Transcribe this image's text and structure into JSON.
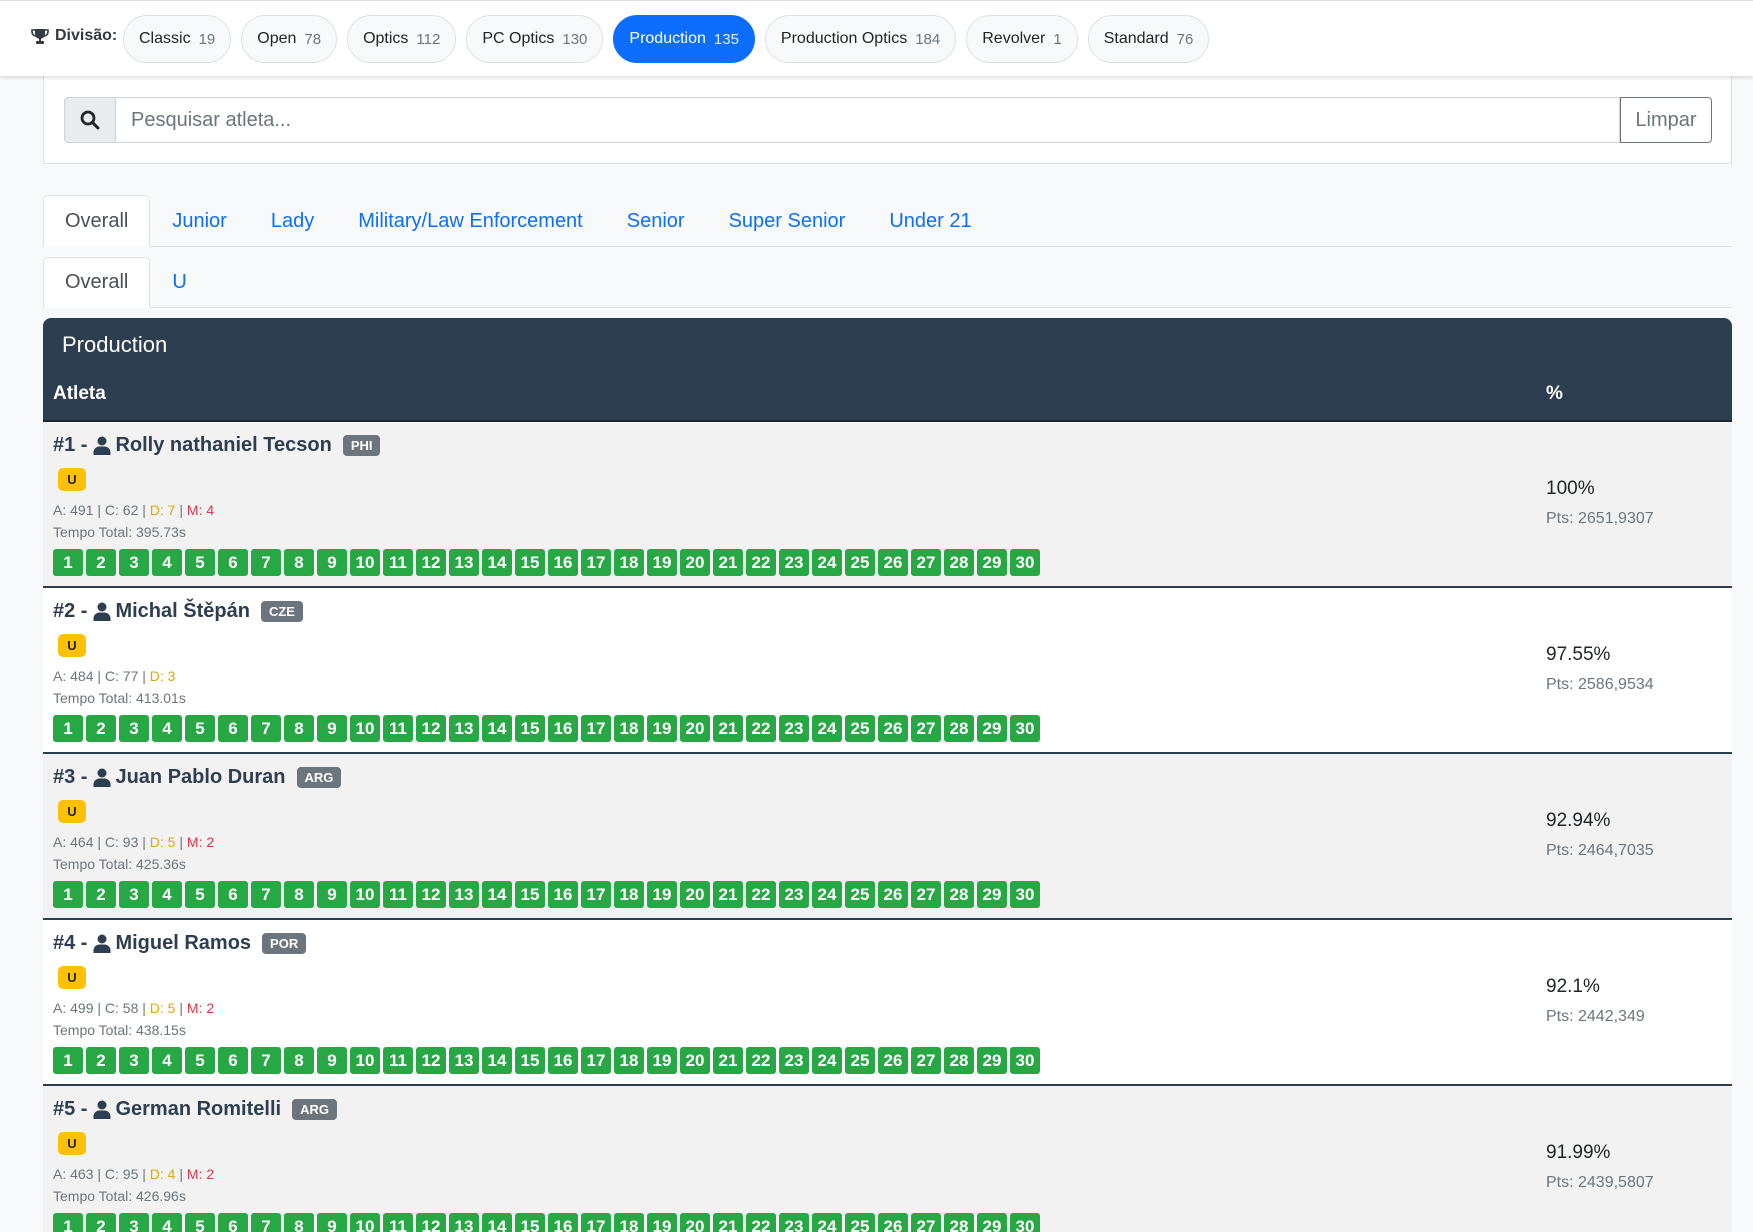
{
  "division": {
    "label": "Divisão:",
    "pills": [
      {
        "name": "Classic",
        "count": "19",
        "active": false
      },
      {
        "name": "Open",
        "count": "78",
        "active": false
      },
      {
        "name": "Optics",
        "count": "112",
        "active": false
      },
      {
        "name": "PC Optics",
        "count": "130",
        "active": false
      },
      {
        "name": "Production",
        "count": "135",
        "active": true
      },
      {
        "name": "Production Optics",
        "count": "184",
        "active": false
      },
      {
        "name": "Revolver",
        "count": "1",
        "active": false
      },
      {
        "name": "Standard",
        "count": "76",
        "active": false
      }
    ]
  },
  "search": {
    "placeholder": "Pesquisar atleta...",
    "value": "",
    "clear_label": "Limpar"
  },
  "category_tabs": [
    {
      "label": "Overall",
      "active": true
    },
    {
      "label": "Junior",
      "active": false
    },
    {
      "label": "Lady",
      "active": false
    },
    {
      "label": "Military/Law Enforcement",
      "active": false
    },
    {
      "label": "Senior",
      "active": false
    },
    {
      "label": "Super Senior",
      "active": false
    },
    {
      "label": "Under 21",
      "active": false
    }
  ],
  "sub_tabs": [
    {
      "label": "Overall",
      "active": true
    },
    {
      "label": "U",
      "active": false
    }
  ],
  "results": {
    "title": "Production",
    "col_athlete": "Atleta",
    "col_percent": "%",
    "stages": [
      "1",
      "2",
      "3",
      "4",
      "5",
      "6",
      "7",
      "8",
      "9",
      "10",
      "11",
      "12",
      "13",
      "14",
      "15",
      "16",
      "17",
      "18",
      "19",
      "20",
      "21",
      "22",
      "23",
      "24",
      "25",
      "26",
      "27",
      "28",
      "29",
      "30"
    ],
    "rows": [
      {
        "rank": "#1 -",
        "name": "Rolly nathaniel Tecson",
        "country": "PHI",
        "badge": "U",
        "a": "A: 491",
        "c": "C: 62",
        "d": "D: 7",
        "m": "M: 4",
        "time": "Tempo Total: 395.73s",
        "percent": "100%",
        "points": "Pts: 2651,9307"
      },
      {
        "rank": "#2 -",
        "name": "Michal Štěpán",
        "country": "CZE",
        "badge": "U",
        "a": "A: 484",
        "c": "C: 77",
        "d": "D: 3",
        "m": "",
        "time": "Tempo Total: 413.01s",
        "percent": "97.55%",
        "points": "Pts: 2586,9534"
      },
      {
        "rank": "#3 -",
        "name": "Juan Pablo Duran",
        "country": "ARG",
        "badge": "U",
        "a": "A: 464",
        "c": "C: 93",
        "d": "D: 5",
        "m": "M: 2",
        "time": "Tempo Total: 425.36s",
        "percent": "92.94%",
        "points": "Pts: 2464,7035"
      },
      {
        "rank": "#4 -",
        "name": "Miguel Ramos",
        "country": "POR",
        "badge": "U",
        "a": "A: 499",
        "c": "C: 58",
        "d": "D: 5",
        "m": "M: 2",
        "time": "Tempo Total: 438.15s",
        "percent": "92.1%",
        "points": "Pts: 2442,349"
      },
      {
        "rank": "#5 -",
        "name": "German Romitelli",
        "country": "ARG",
        "badge": "U",
        "a": "A: 463",
        "c": "C: 95",
        "d": "D: 4",
        "m": "M: 2",
        "time": "Tempo Total: 426.96s",
        "percent": "91.99%",
        "points": "Pts: 2439,5807"
      }
    ]
  },
  "icons": {
    "division": "trophy-icon",
    "search": "search-icon",
    "athlete": "person-icon"
  },
  "colors": {
    "primary": "#0d6efd",
    "header_bg": "#2c3e50",
    "stage_ok": "#28a745",
    "badge_u": "#ffc107",
    "country_badge": "#6c757d",
    "down": "#e0a800",
    "miss": "#dc3545"
  }
}
